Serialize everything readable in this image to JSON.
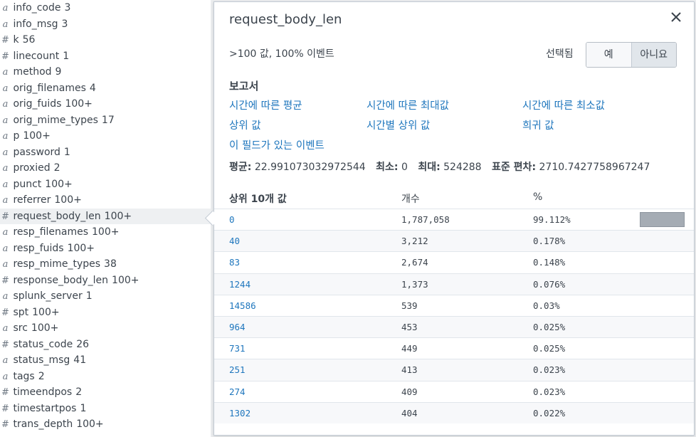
{
  "fields": [
    {
      "type": "a",
      "name": "info_code",
      "count": "3"
    },
    {
      "type": "a",
      "name": "info_msg",
      "count": "3"
    },
    {
      "type": "#",
      "name": "k",
      "count": "56"
    },
    {
      "type": "#",
      "name": "linecount",
      "count": "1"
    },
    {
      "type": "a",
      "name": "method",
      "count": "9"
    },
    {
      "type": "a",
      "name": "orig_filenames",
      "count": "4"
    },
    {
      "type": "a",
      "name": "orig_fuids",
      "count": "100+"
    },
    {
      "type": "a",
      "name": "orig_mime_types",
      "count": "17"
    },
    {
      "type": "a",
      "name": "p",
      "count": "100+"
    },
    {
      "type": "a",
      "name": "password",
      "count": "1"
    },
    {
      "type": "a",
      "name": "proxied",
      "count": "2"
    },
    {
      "type": "a",
      "name": "punct",
      "count": "100+"
    },
    {
      "type": "a",
      "name": "referrer",
      "count": "100+"
    },
    {
      "type": "#",
      "name": "request_body_len",
      "count": "100+",
      "selected": true
    },
    {
      "type": "a",
      "name": "resp_filenames",
      "count": "100+"
    },
    {
      "type": "a",
      "name": "resp_fuids",
      "count": "100+"
    },
    {
      "type": "a",
      "name": "resp_mime_types",
      "count": "38"
    },
    {
      "type": "#",
      "name": "response_body_len",
      "count": "100+"
    },
    {
      "type": "a",
      "name": "splunk_server",
      "count": "1"
    },
    {
      "type": "#",
      "name": "spt",
      "count": "100+"
    },
    {
      "type": "a",
      "name": "src",
      "count": "100+"
    },
    {
      "type": "#",
      "name": "status_code",
      "count": "26"
    },
    {
      "type": "a",
      "name": "status_msg",
      "count": "41"
    },
    {
      "type": "a",
      "name": "tags",
      "count": "2"
    },
    {
      "type": "#",
      "name": "timeendpos",
      "count": "2"
    },
    {
      "type": "#",
      "name": "timestartpos",
      "count": "1"
    },
    {
      "type": "#",
      "name": "trans_depth",
      "count": "100+"
    }
  ],
  "popover": {
    "title": "request_body_len",
    "summary": ">100 값, 100% 이벤트",
    "selected_label": "선택됨",
    "selected_yes": "예",
    "selected_no": "아니요",
    "reports_heading": "보고서",
    "reports": [
      {
        "label": "시간에 따른 평균"
      },
      {
        "label": "시간에 따른 최대값"
      },
      {
        "label": "시간에 따른 최소값"
      },
      {
        "label": "상위 값"
      },
      {
        "label": "시간별 상위 값"
      },
      {
        "label": "희귀 값"
      },
      {
        "label": "이 필드가 있는 이벤트"
      }
    ],
    "stats": {
      "avg_label": "평균:",
      "avg_value": "22.991073032972544",
      "min_label": "최소:",
      "min_value": "0",
      "max_label": "최대:",
      "max_value": "524288",
      "std_label": "표준 편차:",
      "std_value": "2710.7427758967247"
    },
    "table": {
      "headers": [
        "상위 10개 값",
        "개수",
        "%"
      ],
      "rows": [
        {
          "value": "0",
          "count": "1,787,058",
          "percent": "99.112%",
          "fraction": 0.99112
        },
        {
          "value": "40",
          "count": "3,212",
          "percent": "0.178%",
          "fraction": 0.00178
        },
        {
          "value": "83",
          "count": "2,674",
          "percent": "0.148%",
          "fraction": 0.00148
        },
        {
          "value": "1244",
          "count": "1,373",
          "percent": "0.076%",
          "fraction": 0.00076
        },
        {
          "value": "14586",
          "count": "539",
          "percent": "0.03%",
          "fraction": 0.0003
        },
        {
          "value": "964",
          "count": "453",
          "percent": "0.025%",
          "fraction": 0.00025
        },
        {
          "value": "731",
          "count": "449",
          "percent": "0.025%",
          "fraction": 0.00025
        },
        {
          "value": "251",
          "count": "413",
          "percent": "0.023%",
          "fraction": 0.00023
        },
        {
          "value": "274",
          "count": "409",
          "percent": "0.023%",
          "fraction": 0.00023
        },
        {
          "value": "1302",
          "count": "404",
          "percent": "0.022%",
          "fraction": 0.00022
        }
      ]
    }
  },
  "colors": {
    "link": "#1e76bd",
    "text": "#3c444d",
    "bar": "#a5acb4"
  },
  "icons": {
    "close": "close-icon",
    "text_type": "text-field-type-icon",
    "number_type": "number-field-type-icon"
  }
}
